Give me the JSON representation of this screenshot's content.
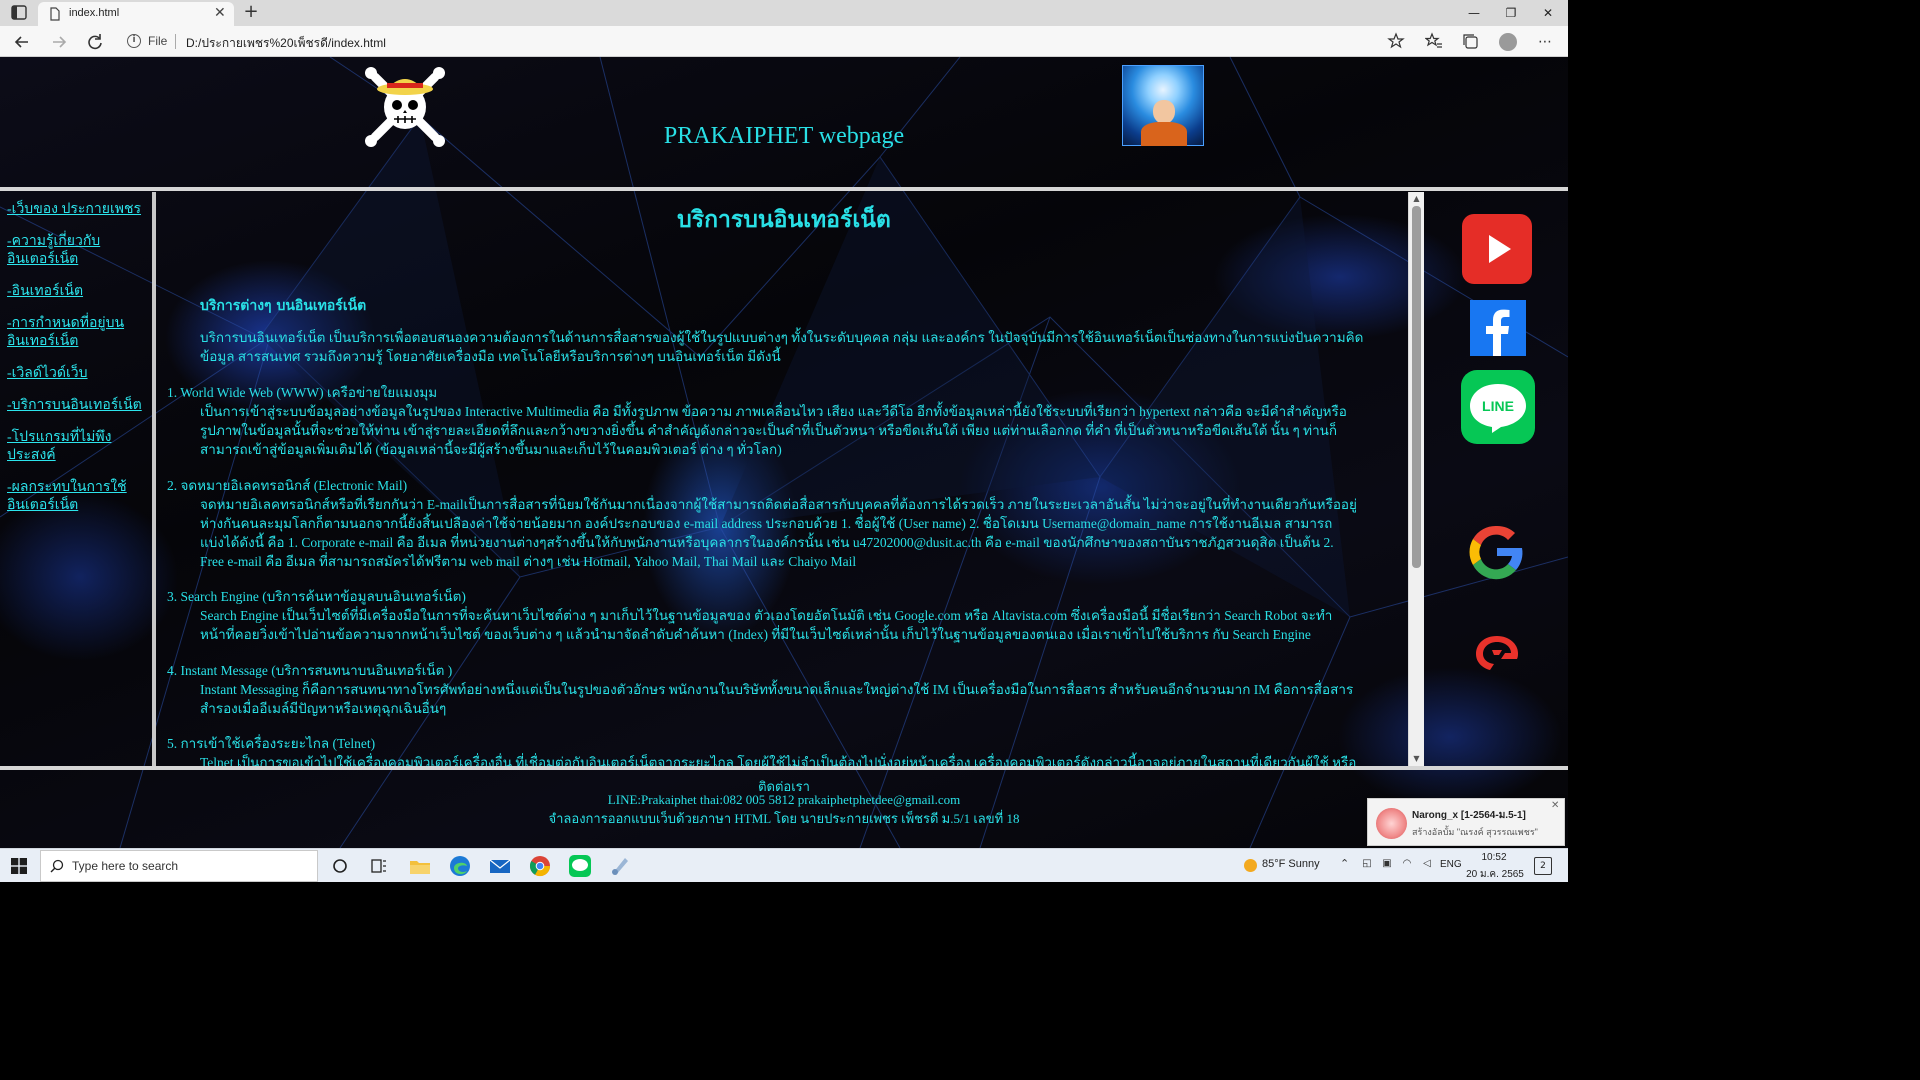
{
  "browser": {
    "tab_title": "index.html",
    "tab_close": "✕",
    "new_tab": "+",
    "address_scheme": "File",
    "address_url": "D:/ประกายเพชร%20เพ็ชรดี/index.html",
    "window_controls": {
      "minimize": "—",
      "restore": "❐",
      "close": "✕"
    },
    "toolbar_icons": [
      "add-favorite-icon",
      "favorites-icon",
      "collections-icon",
      "profile-icon",
      "more-icon"
    ]
  },
  "header": {
    "title": "PRAKAIPHET webpage"
  },
  "sidebar": {
    "links": [
      {
        "label": "-เว็บของ ประกายเพชร"
      },
      {
        "label": "-ความรู้เกี่ยวกับอินเตอร์เน็ต"
      },
      {
        "label": "-อินเทอร์เน็ต"
      },
      {
        "label": "-การกำหนดที่อยู่บนอินเทอร์เน็ต"
      },
      {
        "label": "-เวิลด์ไวด์เว็บ"
      },
      {
        "label": "-บริการบนอินเทอร์เน็ต"
      },
      {
        "label": "-โปรแกรมที่ไม่พึงประสงค์"
      },
      {
        "label": "-ผลกระทบในการใช้อินเตอร์เน็ต"
      }
    ]
  },
  "content": {
    "title": "บริการบนอินเทอร์เน็ต",
    "subtitle": "บริการต่างๆ บนอินเทอร์เน็ต",
    "intro": [
      "บริการบนอินเทอร์เน็ต เป็นบริการเพื่อตอบสนองความต้องการในด้านการสื่อสารของผู้ใช้ในรูปแบบต่างๆ ทั้งในระดับบุคคล กลุ่ม และองค์กร ในปัจจุบันมีการใช้อินเทอร์เน็ตเป็นช่องทางในการแบ่งปันความคิด",
      "ข้อมูล สารสนเทศ รวมถึงความรู้ โดยอาศัยเครื่องมือ เทคโนโลยีหรือบริการต่างๆ บนอินเทอร์เน็ต มีดังนี้"
    ],
    "sections": [
      {
        "heading": "1. World Wide Web (WWW) เครือข่ายใยแมงมุม",
        "lines": [
          "เป็นการเข้าสู่ระบบข้อมูลอย่างข้อมูลในรูปของ Interactive Multimedia คือ มีทั้งรูปภาพ ข้อความ ภาพเคลื่อนไหว เสียง และวีดีโอ อีกทั้งข้อมูลเหล่านี้ยังใช้ระบบที่เรียกว่า hypertext กล่าวคือ จะมีคำสำคัญหรือ",
          "รูปภาพในข้อมูลนั้นที่จะช่วยให้ท่าน เข้าสู่รายละเอียดที่ลึกและกว้างขวางยิ่งขึ้น คำสำคัญดังกล่าวจะเป็นคำที่เป็นตัวหนา หรือขีดเส้นใต้ เพียง แต่ท่านเลือกกด ที่คำ ที่เป็นตัวหนาหรือขีดเส้นใต้ นั้น ๆ ท่านก็",
          "สามารถเข้าสู่ข้อมูลเพิ่มเติมได้ (ข้อมูลเหล่านี้จะมีผู้สร้างขึ้นมาและเก็บไว้ในคอมพิวเตอร์ ต่าง ๆ ทั่วโลก)"
        ]
      },
      {
        "heading": "2. จดหมายอิเลคทรอนิกส์ (Electronic Mail)",
        "lines": [
          "จดหมายอิเลคทรอนิกส์หรือที่เรียกกันว่า E-mailเป็นการสื่อสารที่นิยมใช้กันมากเนื่องจากผู้ใช้สามารถติดต่อสื่อสารกับบุคคลที่ต้องการได้รวดเร็ว ภายในระยะเวลาอันสั้น ไม่ว่าจะอยู่ในที่ทำงานเดียวกันหรืออยู่",
          "ห่างกันคนละมุมโลกก็ตามนอกจากนี้ยังสิ้นเปลืองค่าใช้จ่ายน้อยมาก องค์ประกอบของ e-mail address ประกอบด้วย 1. ชื่อผู้ใช้ (User name) 2. ชื่อโดเมน Username@domain_name การใช้งานอีเมล สามารถ",
          "แบ่งได้ดังนี้ คือ 1. Corporate e-mail คือ อีเมล ที่หน่วยงานต่างๆสร้างขึ้นให้กับพนักงานหรือบุคลากรในองค์กรนั้น เช่น u47202000@dusit.ac.th คือ e-mail ของนักศึกษาของสถาบันราชภัฏสวนดุสิต เป็นต้น 2.",
          "Free e-mail คือ อีเมล ที่สามารถสมัครได้ฟรีตาม web mail ต่างๆ เช่น Hotmail, Yahoo Mail, Thai Mail และ Chaiyo Mail"
        ]
      },
      {
        "heading": "3. Search Engine (บริการค้นหาข้อมูลบนอินเทอร์เน็ต)",
        "lines": [
          "Search Engine เป็นเว็บไซต์ที่มีเครื่องมือในการที่จะค้นหาเว็บไซต์ต่าง ๆ มาเก็บไว้ในฐานข้อมูลของ ตัวเองโดยอัตโนมัติ เช่น Google.com หรือ Altavista.com ซึ่งเครื่องมือนี้ มีชื่อเรียกว่า Search Robot จะทำ",
          "หน้าที่คอยวิ่งเข้าไปอ่านข้อความจากหน้าเว็บไซต์ ของเว็บต่าง ๆ แล้วนำมาจัดลำดับคำค้นหา (Index) ที่มีในเว็บไซต์เหล่านั้น เก็บไว้ในฐานข้อมูลของตนเอง เมื่อเราเข้าไปใช้บริการ กับ Search Engine"
        ]
      },
      {
        "heading": "4. Instant Message (บริการสนทนาบนอินเทอร์เน็ต )",
        "lines": [
          "Instant Messaging ก็คือการสนทนาทางโทรศัพท์อย่างหนึ่งแต่เป็นในรูปของตัวอักษร พนักงานในบริษัททั้งขนาดเล็กและใหญ่ต่างใช้ IM เป็นเครื่องมือในการสื่อสาร สำหรับคนอีกจำนวนมาก IM คือการสื่อสาร",
          "สำรองเมื่ออีเมล์มีปัญหาหรือเหตุฉุกเฉินอื่นๆ"
        ]
      },
      {
        "heading": "5. การเข้าใช้เครื่องระยะไกล (Telnet)",
        "lines": [
          "Telnet เป็นการขอเข้าไปใช้เครื่องคอมพิวเตอร์เครื่องอื่น ที่เชื่อมต่อกับอินเตอร์เน็ตจากระยะไกล โดยผู้ใช้ไม่จำเป็นต้องไปนั่งอยู่หน้าเครื่อง เครื่องคอมพิวเตอร์ดังกล่าวนี้อาจอยู่ภายในสถานที่เดียวกันผู้ใช้ หรือ"
        ]
      }
    ]
  },
  "social": [
    {
      "name": "youtube",
      "color": "#e52d27"
    },
    {
      "name": "facebook",
      "color": "#1877f2"
    },
    {
      "name": "line",
      "color": "#06c755",
      "label": "LINE"
    },
    {
      "name": "google",
      "color": "#4285f4"
    },
    {
      "name": "garena",
      "color": "#e8322b"
    }
  ],
  "footer": {
    "contact_title": "ติดต่อเรา",
    "contact_line": "LINE:Prakaiphet thai:082 005 5812 prakaiphetphetdee@gmail.com",
    "credit_line": "จำลองการออกแบบเว็บด้วยภาษา HTML โดย นายประกายเพชร เพ็ชรดี ม.5/1 เลขที่ 18"
  },
  "notification": {
    "title": "Narong_x [1-2564-ม.5-1]",
    "body": "สร้างอัลบั้ม \"ณรงค์ สุวรรณเพชร\"",
    "close": "✕"
  },
  "taskbar": {
    "search_placeholder": "Type here to search",
    "apps": [
      "task-view-icon",
      "widgets-icon",
      "file-explorer-icon",
      "edge-icon",
      "mail-icon",
      "chrome-icon",
      "line-app-icon",
      "extra-app-icon"
    ],
    "weather": "85°F  Sunny",
    "language": "ENG",
    "time": "10:52",
    "date": "20 ม.ค. 2565",
    "notification_count": "2"
  },
  "colors": {
    "accent_cyan": "#29e0e6",
    "link_cyan": "#2ce4ec"
  }
}
